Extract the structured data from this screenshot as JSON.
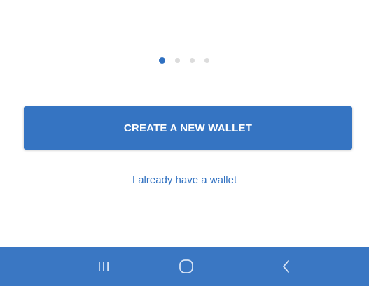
{
  "pager": {
    "page_count": 4,
    "active_page": 1
  },
  "actions": {
    "create_label": "CREATE A NEW WALLET",
    "existing_label": "I already have a wallet"
  },
  "system_nav": {
    "icons": [
      "recent-apps-icon",
      "home-icon",
      "back-icon"
    ]
  },
  "colors": {
    "primary": "#3574c2",
    "nav_bar": "#3a77c3",
    "dot_inactive": "#dcdcdc",
    "link": "#2f70c1"
  }
}
